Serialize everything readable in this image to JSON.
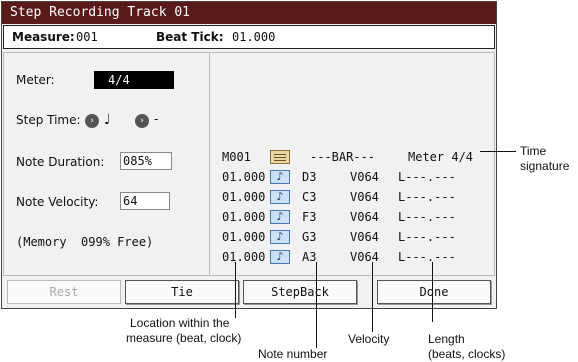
{
  "window": {
    "title": "Step Recording Track 01"
  },
  "header": {
    "measure_label": "Measure:",
    "measure_value": "001",
    "beat_tick_label": "Beat Tick:",
    "beat_tick_value": "01.000"
  },
  "left": {
    "meter_label": "Meter:",
    "meter_value": "4/4",
    "step_time_label": "Step Time:",
    "step_time_note": "♩",
    "step_time_mod": "-",
    "note_duration_label": "Note Duration:",
    "note_duration_value": "085%",
    "note_velocity_label": "Note Velocity:",
    "note_velocity_value": "64",
    "memory_text": "(Memory  099% Free)"
  },
  "event_list": {
    "bar_row": {
      "measure": "M001",
      "bar": "---BAR---",
      "meter": "Meter 4/4"
    },
    "notes": [
      {
        "location": "01.000",
        "note": "D3",
        "velocity": "V064",
        "length": "L---.---"
      },
      {
        "location": "01.000",
        "note": "C3",
        "velocity": "V064",
        "length": "L---.---"
      },
      {
        "location": "01.000",
        "note": "F3",
        "velocity": "V064",
        "length": "L---.---"
      },
      {
        "location": "01.000",
        "note": "G3",
        "velocity": "V064",
        "length": "L---.---"
      },
      {
        "location": "01.000",
        "note": "A3",
        "velocity": "V064",
        "length": "L---.---"
      }
    ],
    "note_icon": "♪"
  },
  "buttons": {
    "rest": "Rest",
    "tie": "Tie",
    "stepback": "StepBack",
    "done": "Done"
  },
  "callouts": {
    "time_signature_1": "Time",
    "time_signature_2": "signature",
    "location_1": "Location within the",
    "location_2": "measure (beat, clock)",
    "note_number": "Note number",
    "velocity": "Velocity",
    "length_1": "Length",
    "length_2": "(beats, clocks)"
  },
  "colors": {
    "title_bar": "#5a1a1a",
    "note_icon_fill": "#cce0f5",
    "bar_icon_fill": "#e8d8a0"
  }
}
